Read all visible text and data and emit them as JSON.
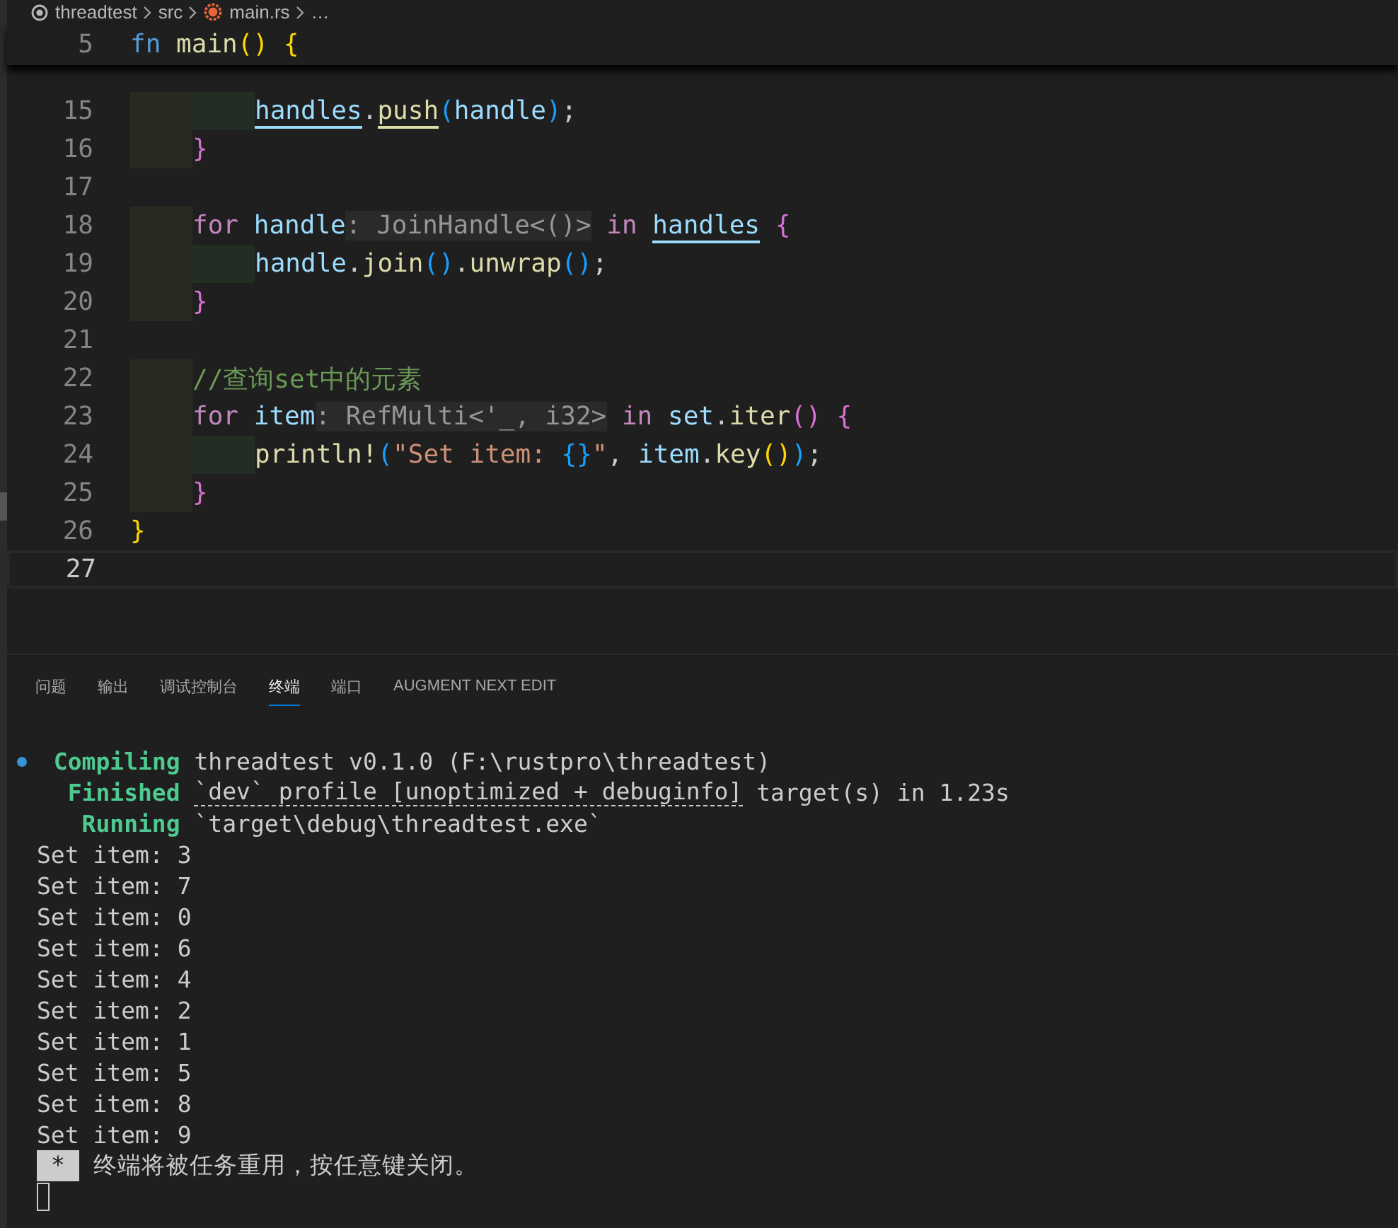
{
  "breadcrumb": {
    "items": [
      {
        "text": "threadtest"
      },
      {
        "text": "src"
      },
      {
        "text": "main.rs"
      },
      {
        "text": "…"
      }
    ]
  },
  "sticky_line": {
    "number": "5",
    "tokens": [
      {
        "text": "fn ",
        "kind": "keyword"
      },
      {
        "text": "main",
        "kind": "function"
      },
      {
        "text": "()",
        "kind": "brace1"
      },
      {
        "text": " {",
        "kind": "brace1"
      }
    ]
  },
  "code_lines": [
    {
      "children": [
        {
          "children": [
            {
              "number": "15",
              "current": false,
              "tokens": [
                {
                  "text": "handles",
                  "kind": "variable-underlined"
                },
                {
                  "text": ".",
                  "kind": "plain"
                },
                {
                  "text": "push",
                  "kind": "function-underlined"
                },
                {
                  "text": "(",
                  "kind": "brace3"
                },
                {
                  "text": "handle",
                  "kind": "variable"
                },
                {
                  "text": ")",
                  "kind": "brace3"
                },
                {
                  "text": ";",
                  "kind": "plain"
                }
              ]
            }
          ]
        },
        {
          "number": "16",
          "current": false,
          "tokens": [
            {
              "text": "}",
              "kind": "brace2"
            }
          ]
        },
        {
          "number": "17",
          "current": false
        },
        {
          "number": "18",
          "current": false,
          "tokens": [
            {
              "text": "for ",
              "kind": "control"
            },
            {
              "text": "handle",
              "kind": "variable"
            },
            {
              "text": ": JoinHandle<()>",
              "kind": "hint"
            },
            {
              "text": " in ",
              "kind": "control"
            },
            {
              "text": "handles",
              "kind": "variable-underlined"
            },
            {
              "text": " {",
              "kind": "brace2"
            }
          ],
          "children": [
            {
              "number": "19",
              "current": false,
              "tokens": [
                {
                  "text": "handle",
                  "kind": "variable"
                },
                {
                  "text": ".",
                  "kind": "plain"
                },
                {
                  "text": "join",
                  "kind": "function"
                },
                {
                  "text": "()",
                  "kind": "brace3"
                },
                {
                  "text": ".",
                  "kind": "plain"
                },
                {
                  "text": "unwrap",
                  "kind": "function"
                },
                {
                  "text": "()",
                  "kind": "brace3"
                },
                {
                  "text": ";",
                  "kind": "plain"
                }
              ]
            }
          ]
        },
        {
          "number": "20",
          "current": false,
          "tokens": [
            {
              "text": "}",
              "kind": "brace2"
            }
          ]
        },
        {
          "number": "21",
          "current": false
        },
        {
          "number": "22",
          "current": false,
          "tokens": [
            {
              "text": "//查询set中的元素",
              "kind": "comment"
            }
          ]
        },
        {
          "number": "23",
          "current": false,
          "tokens": [
            {
              "text": "for ",
              "kind": "control"
            },
            {
              "text": "item",
              "kind": "variable"
            },
            {
              "text": ": RefMulti<'_, i32>",
              "kind": "hint"
            },
            {
              "text": " in ",
              "kind": "control"
            },
            {
              "text": "set",
              "kind": "variable"
            },
            {
              "text": ".",
              "kind": "plain"
            },
            {
              "text": "iter",
              "kind": "function"
            },
            {
              "text": "()",
              "kind": "brace2"
            },
            {
              "text": " {",
              "kind": "brace2"
            }
          ],
          "children": [
            {
              "number": "24",
              "current": false,
              "tokens": [
                {
                  "text": "println!",
                  "kind": "function"
                },
                {
                  "text": "(",
                  "kind": "brace3"
                },
                {
                  "text": "\"Set item: ",
                  "kind": "string"
                },
                {
                  "text": "{}",
                  "kind": "brace3"
                },
                {
                  "text": "\"",
                  "kind": "string"
                },
                {
                  "text": ", ",
                  "kind": "plain"
                },
                {
                  "text": "item",
                  "kind": "variable"
                },
                {
                  "text": ".",
                  "kind": "plain"
                },
                {
                  "text": "key",
                  "kind": "function"
                },
                {
                  "text": "()",
                  "kind": "brace1"
                },
                {
                  "text": ")",
                  "kind": "brace3"
                },
                {
                  "text": ";",
                  "kind": "plain"
                }
              ]
            }
          ]
        },
        {
          "number": "25",
          "current": false,
          "tokens": [
            {
              "text": "}",
              "kind": "brace2"
            }
          ]
        }
      ]
    },
    {
      "number": "26",
      "current": false,
      "tokens": [
        {
          "text": "}",
          "kind": "brace1"
        }
      ]
    },
    {
      "number": "27",
      "current": true
    }
  ],
  "panel_tabs": [
    {
      "label": "问题",
      "selected": false
    },
    {
      "label": "输出",
      "selected": false
    },
    {
      "label": "调试控制台",
      "selected": false
    },
    {
      "label": "终端",
      "selected": true
    },
    {
      "label": "端口",
      "selected": false
    },
    {
      "label": "AUGMENT NEXT EDIT",
      "selected": false
    }
  ],
  "terminal_lines": [
    {
      "kind": "status",
      "decorated": true,
      "label": "Compiling",
      "parts": [
        {
          "text": "threadtest v0.1.0 (F:\\rustpro\\threadtest)",
          "kind": "plain"
        }
      ]
    },
    {
      "kind": "status",
      "decorated": false,
      "label": "Finished",
      "parts": [
        {
          "text": "`dev` profile [unoptimized + debuginfo]",
          "kind": "link"
        },
        {
          "text": " target(s) in 1.23s",
          "kind": "plain"
        }
      ]
    },
    {
      "kind": "status",
      "decorated": false,
      "label": "Running",
      "parts": [
        {
          "text": "`target\\debug\\threadtest.exe`",
          "kind": "plain"
        }
      ]
    },
    {
      "kind": "output",
      "text": "Set item: 3"
    },
    {
      "kind": "output",
      "text": "Set item: 7"
    },
    {
      "kind": "output",
      "text": "Set item: 0"
    },
    {
      "kind": "output",
      "text": "Set item: 6"
    },
    {
      "kind": "output",
      "text": "Set item: 4"
    },
    {
      "kind": "output",
      "text": "Set item: 2"
    },
    {
      "kind": "output",
      "text": "Set item: 1"
    },
    {
      "kind": "output",
      "text": "Set item: 5"
    },
    {
      "kind": "output",
      "text": "Set item: 8"
    },
    {
      "kind": "output",
      "text": "Set item: 9"
    },
    {
      "kind": "notice",
      "badge": "*",
      "text": "终端将被任务重用，按任意键关闭。"
    },
    {
      "kind": "cursor"
    }
  ]
}
